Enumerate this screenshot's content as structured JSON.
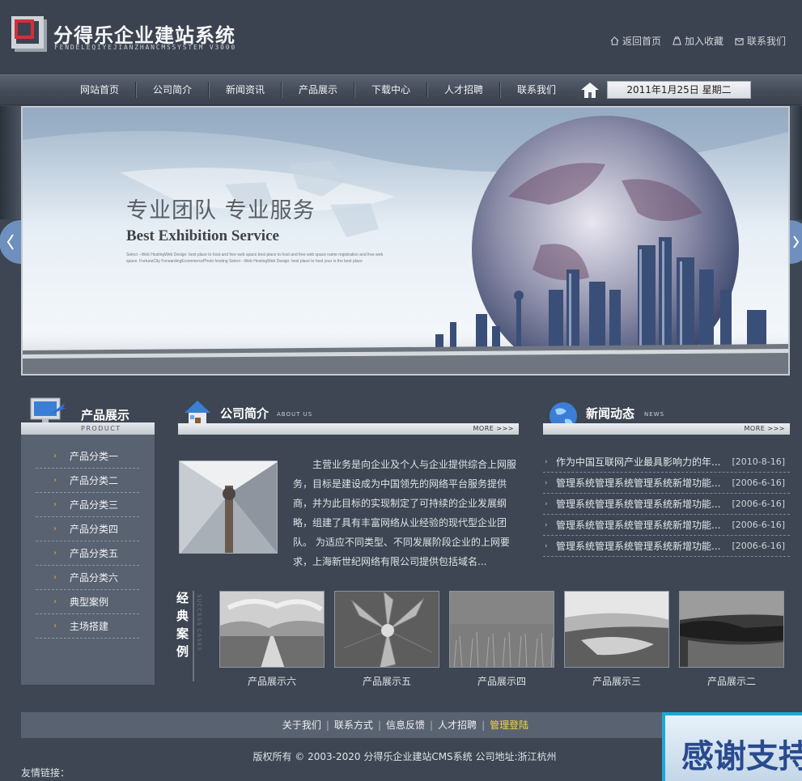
{
  "header": {
    "title": "分得乐企业建站系统",
    "subtitle": "FENDELEQIYEJIANZHANCMSSYSTEM V3000",
    "links": [
      {
        "label": "返回首页",
        "icon": "home-icon"
      },
      {
        "label": "加入收藏",
        "icon": "favorite-icon"
      },
      {
        "label": "联系我们",
        "icon": "contact-icon"
      }
    ]
  },
  "nav": {
    "items": [
      "网站首页",
      "公司简介",
      "新闻资讯",
      "产品展示",
      "下载中心",
      "人才招聘",
      "联系我们"
    ],
    "date": "2011年1月25日 星期二"
  },
  "banner": {
    "headline_cn": "专业团队 专业服务",
    "headline_en": "Best Exhibition Service",
    "small_text": "Select --Web HostingWeb Design: best place to host and free web space best place to host and free web space name registration and free web space. FortuneCity ForwardingEcommercePhoto hosting Select --Web HostingWeb Design: best place to host your is the best place"
  },
  "products": {
    "title": "产品展示",
    "subtitle": "PRODUCT",
    "categories": [
      "产品分类一",
      "产品分类二",
      "产品分类三",
      "产品分类四",
      "产品分类五",
      "产品分类六",
      "典型案例",
      "主场搭建"
    ]
  },
  "about": {
    "title": "公司简介",
    "subtitle": "ABOUT US",
    "more": "MORE >>>",
    "text": "主营业务是向企业及个人与企业提供综合上网服务，目标是建设成为中国领先的网络平台服务提供商，并为此目标的实现制定了可持续的企业发展纲略，组建了具有丰富网络从业经验的现代型企业团队。 为适应不同类型、不同发展阶段企业的上网要求，上海新世纪网络有限公司提供包括域名..."
  },
  "news": {
    "title": "新闻动态",
    "subtitle": "NEWS",
    "more": "MORE >>>",
    "items": [
      {
        "title": "作为中国互联网产业最具影响力的年...",
        "date": "[2010-8-16]"
      },
      {
        "title": "管理系统管理系统管理系统新增功能...",
        "date": "[2006-6-16]"
      },
      {
        "title": "管理系统管理系统管理系统新增功能...",
        "date": "[2006-6-16]"
      },
      {
        "title": "管理系统管理系统管理系统新增功能...",
        "date": "[2006-6-16]"
      },
      {
        "title": "管理系统管理系统管理系统新增功能...",
        "date": "[2006-6-16]"
      }
    ]
  },
  "cases": {
    "title": "经典案例",
    "subtitle": "SUCCESS CASES",
    "items": [
      "产品展示六",
      "产品展示五",
      "产品展示四",
      "产品展示三",
      "产品展示二"
    ]
  },
  "footer": {
    "links": [
      "关于我们",
      "联系方式",
      "信息反馈",
      "人才招聘"
    ],
    "admin": "管理登陆",
    "copyright": "版权所有 © 2003-2020 分得乐企业建站CMS系统 公司地址:浙江杭州",
    "friends": "友情链接：",
    "thanks_badge": "感谢支持"
  },
  "colors": {
    "background": "#3d4652",
    "panel": "#596270",
    "accent": "#d9b23a",
    "admin_link": "#f3d24c"
  }
}
